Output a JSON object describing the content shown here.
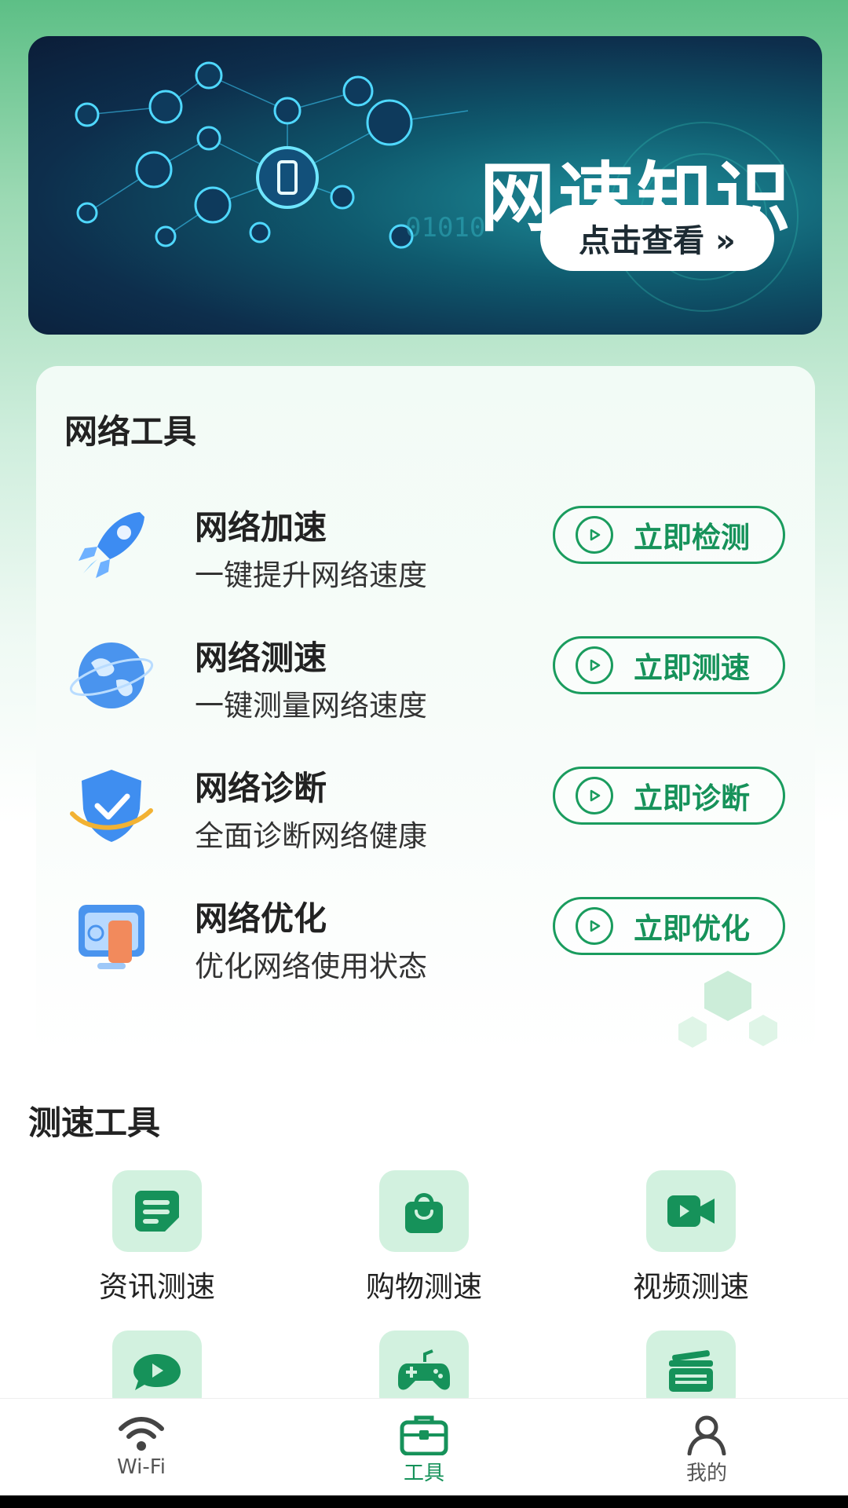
{
  "banner": {
    "title": "网速知识",
    "button_label": "点击查看 »",
    "accent": "#1e8c98",
    "binary_text": "01010"
  },
  "network_tools": {
    "title": "网络工具",
    "items": [
      {
        "name": "网络加速",
        "desc": "一键提升网络速度",
        "button": "立即检测",
        "icon": "rocket-icon"
      },
      {
        "name": "网络测速",
        "desc": "一键测量网络速度",
        "button": "立即测速",
        "icon": "globe-icon"
      },
      {
        "name": "网络诊断",
        "desc": "全面诊断网络健康",
        "button": "立即诊断",
        "icon": "shield-check-icon"
      },
      {
        "name": "网络优化",
        "desc": "优化网络使用状态",
        "button": "立即优化",
        "icon": "monitor-phone-icon"
      }
    ]
  },
  "speed_tools": {
    "title": "测速工具",
    "items": [
      {
        "label": "资讯测速",
        "icon": "news-icon"
      },
      {
        "label": "购物测速",
        "icon": "shopping-bag-icon"
      },
      {
        "label": "视频测速",
        "icon": "video-camera-icon"
      },
      {
        "label": "",
        "icon": "live-play-icon"
      },
      {
        "label": "",
        "icon": "gamepad-icon"
      },
      {
        "label": "",
        "icon": "cards-icon"
      }
    ]
  },
  "tabbar": {
    "tabs": [
      {
        "label": "Wi-Fi",
        "icon": "wifi-icon",
        "active": false
      },
      {
        "label": "工具",
        "icon": "toolbox-icon",
        "active": true
      },
      {
        "label": "我的",
        "icon": "user-icon",
        "active": false
      }
    ],
    "active_color": "#16925a",
    "inactive_color": "#555555"
  },
  "colors": {
    "brand_green": "#1a9c5e",
    "tile_bg": "#d2f1df"
  }
}
